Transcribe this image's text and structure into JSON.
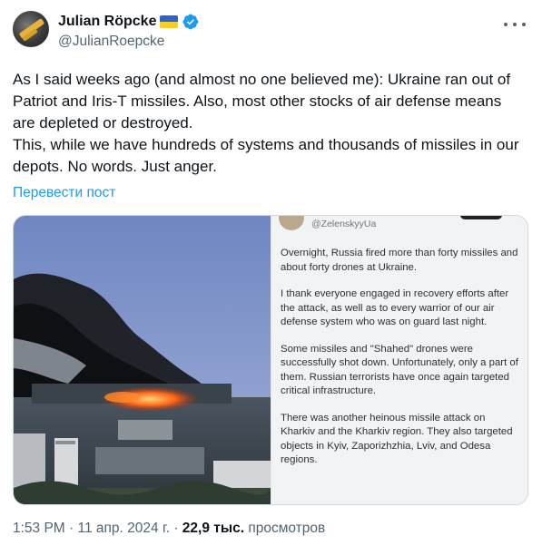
{
  "author": {
    "name": "Julian Röpcke",
    "handle": "@JulianRoepcke",
    "avatar_icon": "profile-photo-icon",
    "flag_icon": "ukraine-flag-icon",
    "verified_icon": "verified-badge-icon"
  },
  "tweet": {
    "line1": "As I said weeks ago (and almost no one believed me): Ukraine ran out of Patriot and Iris-T missiles. Also, most other stocks of air defense means are depleted or destroyed.",
    "line2": "This, while we have hundreds of systems and thousands of missiles in our depots. No words. Just anger."
  },
  "translate_label": "Перевести пост",
  "embedded": {
    "handle": "@ZelenskyyUa",
    "paragraphs": [
      "Overnight, Russia fired more than forty missiles and about forty drones at Ukraine.",
      "I thank everyone engaged in recovery efforts after the attack, as well as to every warrior of our air defense system who was on guard last night.",
      "Some missiles and \"Shahed\" drones were successfully shot down. Unfortunately, only a part of them. Russian terrorists have once again targeted critical infrastructure.",
      "There was another heinous missile attack on Kharkiv and the Kharkiv region. They also targeted objects in Kyiv, Zaporizhzhia, Lviv, and Odesa regions."
    ]
  },
  "meta": {
    "time": "1:53 PM",
    "sep1": " · ",
    "date": "11 апр. 2024 г.",
    "sep2": " · ",
    "views_count": "22,9 тыс.",
    "views_label": " просмотров"
  },
  "colors": {
    "link": "#1d9bf0",
    "secondary": "#536471",
    "text": "#0f1419"
  }
}
